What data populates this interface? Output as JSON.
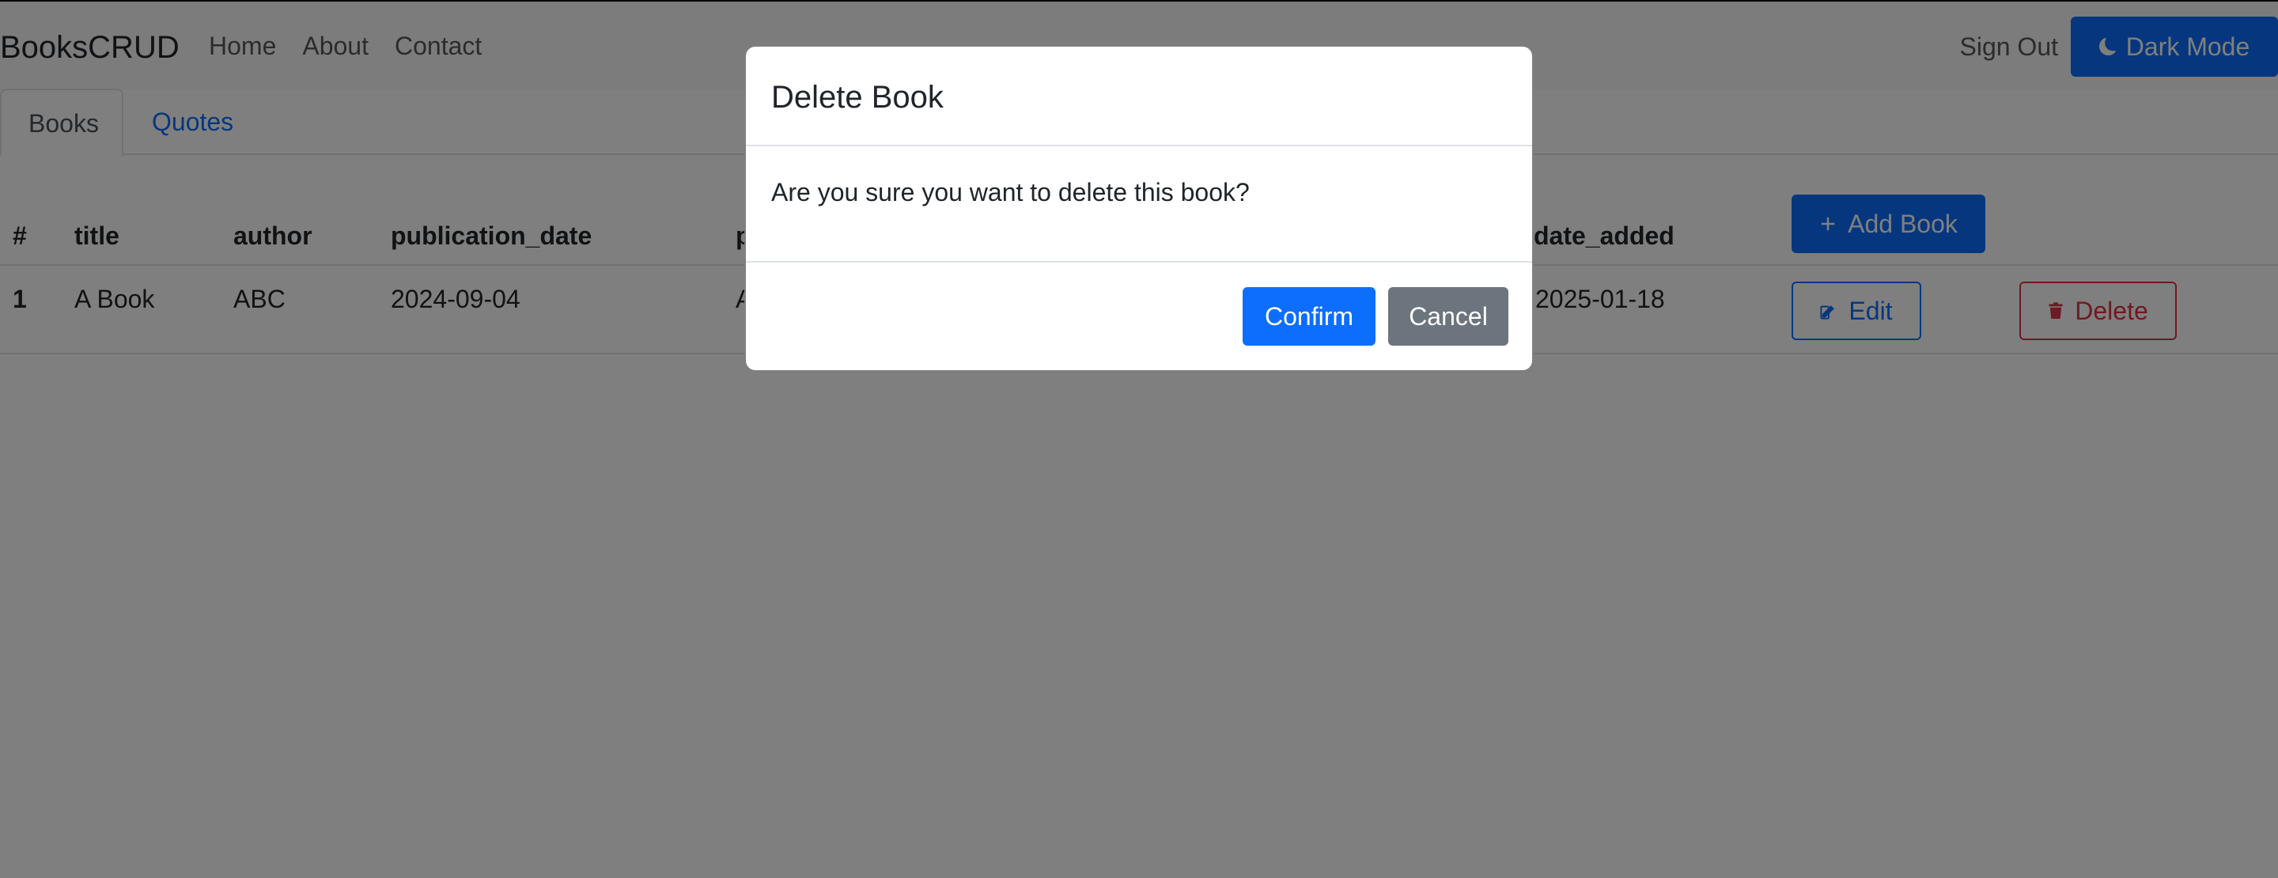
{
  "navbar": {
    "brand": "BooksCRUD",
    "links": [
      "Home",
      "About",
      "Contact"
    ],
    "sign_out": "Sign Out",
    "dark_mode_label": "Dark Mode",
    "dark_mode_icon": "moon-icon"
  },
  "tabs": [
    {
      "label": "Books",
      "active": true
    },
    {
      "label": "Quotes",
      "active": false
    }
  ],
  "table": {
    "headers": [
      "#",
      "title",
      "author",
      "publication_date",
      "p",
      "date_added"
    ],
    "add_button": {
      "label": "Add Book",
      "icon": "plus-icon"
    },
    "rows": [
      {
        "index": "1",
        "title": "A Book",
        "author": "ABC",
        "publication_date": "2024-09-04",
        "p": "A",
        "date_added": "2025-01-18"
      }
    ],
    "edit_button": {
      "label": "Edit",
      "icon": "edit-icon"
    },
    "delete_button": {
      "label": "Delete",
      "icon": "trash-icon"
    }
  },
  "modal": {
    "title": "Delete Book",
    "message": "Are you sure you want to delete this book?",
    "confirm_label": "Confirm",
    "cancel_label": "Cancel"
  },
  "colors": {
    "primary": "#0d6efd",
    "danger": "#dc3545",
    "secondary": "#6c757d",
    "backdrop": "rgba(0,0,0,0.5)"
  }
}
